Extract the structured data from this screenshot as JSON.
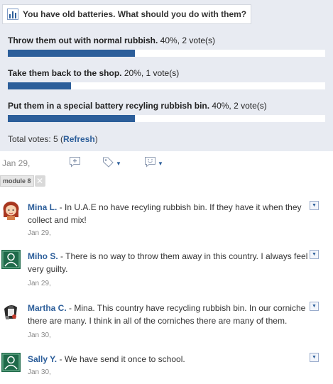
{
  "poll": {
    "question": "You have old batteries. What should you do with them?",
    "options": [
      {
        "label": "Throw them out with normal rubbish.",
        "stats": "40%, 2 vote(s)",
        "percent": 40
      },
      {
        "label": "Take them back to the shop.",
        "stats": "20%, 1 vote(s)",
        "percent": 20
      },
      {
        "label": "Put them in a special battery recyling rubbish bin.",
        "stats": "40%, 2 vote(s)",
        "percent": 40
      }
    ],
    "total_prefix": "Total votes: 5 (",
    "refresh_label": "Refresh",
    "total_suffix": ")"
  },
  "post": {
    "date": "Jan 29,",
    "tag": "module 8",
    "icons": [
      "add-comment-icon",
      "tag-icon",
      "emoticon-icon"
    ]
  },
  "comments": [
    {
      "author": "Mina L.",
      "text": " - In U.A.E no have recyling rubbish bin. If they have it when they collect and mix!",
      "date": "Jan 29,",
      "avatar": "girl-avatar"
    },
    {
      "author": "Miho S.",
      "text": " - There is no way to throw them away in this country. I always feel very guilty.",
      "date": "Jan 29,",
      "avatar": "default-avatar"
    },
    {
      "author": "Martha C.",
      "text": " - Mina. This country have recycling rubbish bin. In our corniche there are many. I think in all of the corniches there are many of them.",
      "date": "Jan 30,",
      "avatar": "character-avatar"
    },
    {
      "author": "Sally Y.",
      "text": " - We have send it once to school.",
      "date": "Jan 30,",
      "avatar": "default-avatar"
    }
  ],
  "colors": {
    "panel_bg": "#e8ebf2",
    "bar_fill": "#2c5e9a",
    "link": "#2c5e9a",
    "muted": "#8a8a8a"
  }
}
